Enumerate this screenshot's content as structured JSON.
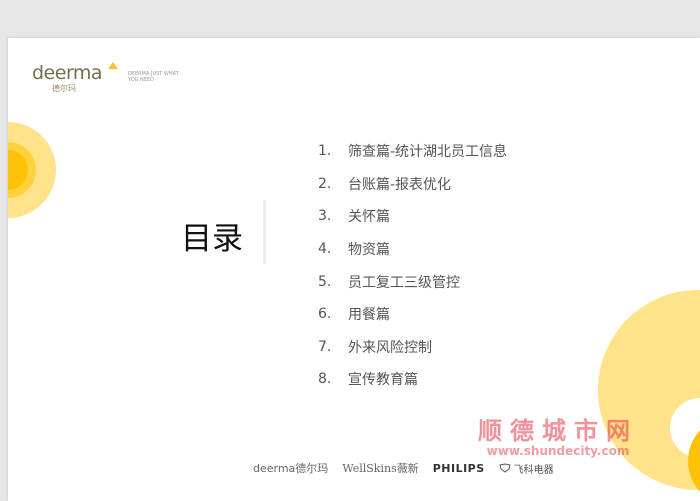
{
  "logo": {
    "word": "deerma",
    "cn": "德尔玛",
    "tagline": "DEERMA JUST WHAT YOU NEED"
  },
  "title": "目录",
  "toc": [
    {
      "num": "1.",
      "text": "筛查篇-统计湖北员工信息"
    },
    {
      "num": "2.",
      "text": "台账篇-报表优化"
    },
    {
      "num": "3.",
      "text": "关怀篇"
    },
    {
      "num": "4.",
      "text": "物资篇"
    },
    {
      "num": "5.",
      "text": "员工复工三级管控"
    },
    {
      "num": "6.",
      "text": "用餐篇"
    },
    {
      "num": "7.",
      "text": "外来风险控制"
    },
    {
      "num": "8.",
      "text": "宣传教育篇"
    }
  ],
  "watermark": {
    "cn": "顺德城市网",
    "url": "www.shundecity.com"
  },
  "brands": {
    "deerma": "deerma德尔玛",
    "wellskins": "WellSkins薇新",
    "philips": "PHILIPS",
    "flyco": "飞科电器"
  },
  "colors": {
    "accent_yellow": "#ffc107",
    "light_yellow": "#ffe38a",
    "watermark_red": "#e63946"
  }
}
